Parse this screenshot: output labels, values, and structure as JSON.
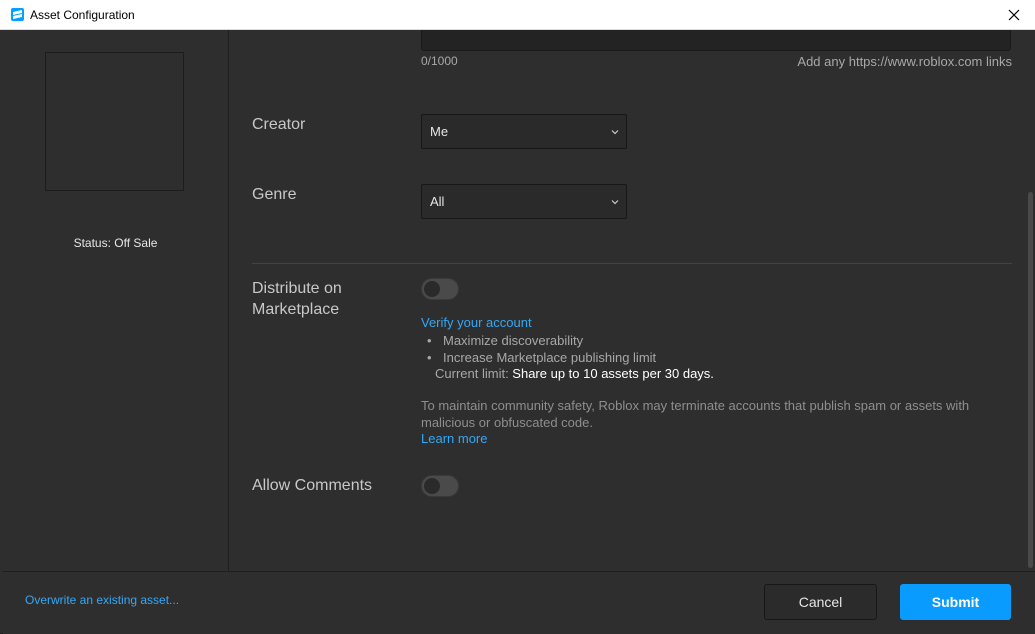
{
  "window": {
    "title": "Asset Configuration"
  },
  "left_panel": {
    "status": "Status: Off Sale"
  },
  "description": {
    "char_count": "0/1000",
    "links_hint": "Add any https://www.roblox.com links"
  },
  "creator": {
    "label": "Creator",
    "value": "Me"
  },
  "genre": {
    "label": "Genre",
    "value": "All"
  },
  "marketplace": {
    "label_line1": "Distribute on",
    "label_line2": "Marketplace",
    "toggle_on": false,
    "verify_link": "Verify your account",
    "bullets": [
      "Maximize discoverability",
      "Increase Marketplace publishing limit"
    ],
    "limit_prefix": "Current limit: ",
    "limit_value": "Share up to 10 assets per 30 days.",
    "safety_text": "To maintain community safety, Roblox may terminate accounts that publish spam or assets with malicious or obfuscated code.",
    "learn_more": "Learn more"
  },
  "comments": {
    "label": "Allow Comments",
    "toggle_on": false
  },
  "footer": {
    "overwrite_link": "Overwrite an existing asset...",
    "cancel_label": "Cancel",
    "submit_label": "Submit"
  },
  "colors": {
    "background": "#2e2e2e",
    "accent": "#0a9bff",
    "link": "#33a8f5"
  },
  "icons": {
    "app": "roblox-studio-icon",
    "close": "close-icon",
    "dropdown": "chevron-down-icon"
  }
}
